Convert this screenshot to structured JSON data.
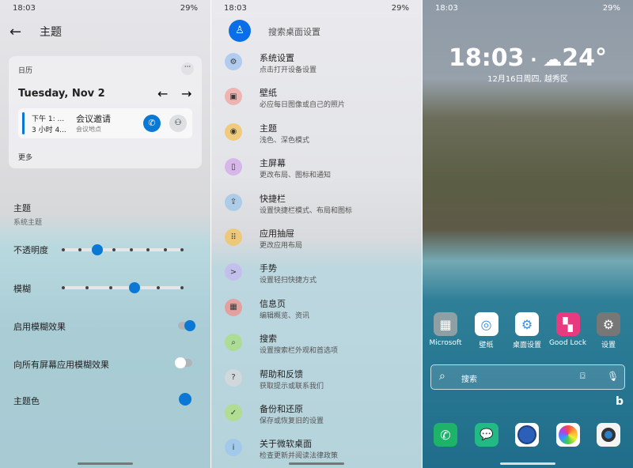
{
  "status": {
    "time": "18:03",
    "battery": "29%"
  },
  "theme_screen": {
    "title": "主题",
    "card": {
      "label": "日历",
      "date": "Tuesday, Nov 2",
      "event_time": "下午 1: ...",
      "event_duration": "3 小时 4...",
      "event_title": "会议邀请",
      "event_location": "会议地点",
      "more": "更多"
    },
    "theme": {
      "label": "主题",
      "value": "系统主题"
    },
    "opacity": {
      "label": "不透明度",
      "stops": 8,
      "selected_index": 2
    },
    "blur": {
      "label": "模糊",
      "stops": 6,
      "selected_index": 3
    },
    "enable_blur": {
      "label": "启用模糊效果",
      "on": true
    },
    "blur_all": {
      "label": "向所有屏幕应用模糊效果",
      "on": false
    },
    "accent": {
      "label": "主题色",
      "color": "#0a78d4"
    }
  },
  "settings_screen": {
    "search_placeholder": "搜索桌面设置",
    "items": [
      {
        "title": "系统设置",
        "subtitle": "点击打开设备设置",
        "icon": "gear-icon",
        "color": "#9fc3ef"
      },
      {
        "title": "壁纸",
        "subtitle": "必应每日图像或自己的照片",
        "icon": "image-icon",
        "color": "#f0a3a0"
      },
      {
        "title": "主题",
        "subtitle": "浅色、深色模式",
        "icon": "palette-icon",
        "color": "#f4c35a"
      },
      {
        "title": "主屏幕",
        "subtitle": "更改布局、图标和通知",
        "icon": "phone-icon",
        "color": "#d3a8ea"
      },
      {
        "title": "快捷栏",
        "subtitle": "设置快捷栏模式、布局和图标",
        "icon": "dock-icon",
        "color": "#9cc6ea"
      },
      {
        "title": "应用抽屉",
        "subtitle": "更改应用布局",
        "icon": "grid-icon",
        "color": "#f4c35a"
      },
      {
        "title": "手势",
        "subtitle": "设置轻扫快捷方式",
        "icon": "gesture-icon",
        "color": "#c6b8f2"
      },
      {
        "title": "信息页",
        "subtitle": "编辑概览、资讯",
        "icon": "feed-icon",
        "color": "#f0908a"
      },
      {
        "title": "搜索",
        "subtitle": "设置搜索栏外观和首选项",
        "icon": "search-icon",
        "color": "#a9de7d"
      },
      {
        "title": "帮助和反馈",
        "subtitle": "获取提示或联系我们",
        "icon": "help-icon",
        "color": "#d8dadc"
      },
      {
        "title": "备份和还原",
        "subtitle": "保存或恢复旧的设置",
        "icon": "backup-icon",
        "color": "#b0e07a"
      },
      {
        "title": "关于微软桌面",
        "subtitle": "检查更新并阅读法律政策",
        "icon": "info-icon",
        "color": "#9cc6ef"
      }
    ]
  },
  "home_screen": {
    "clock": "18:03",
    "temp": "24°",
    "date": "12月16日周四, 越秀区",
    "apps": [
      {
        "label": "Microsoft"
      },
      {
        "label": "壁纸"
      },
      {
        "label": "桌面设置"
      },
      {
        "label": "Good Lock"
      },
      {
        "label": "设置"
      }
    ],
    "search_placeholder": "搜索"
  }
}
